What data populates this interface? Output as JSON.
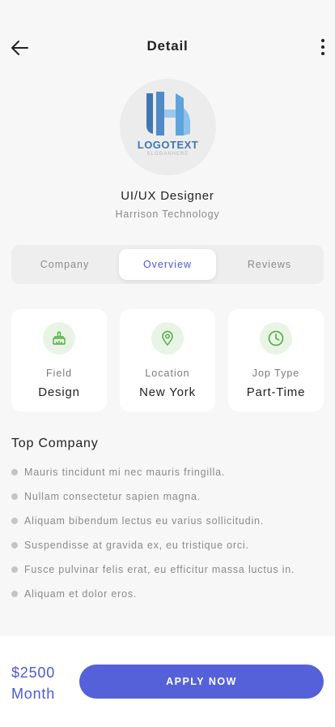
{
  "header": {
    "title": "Detail",
    "back_icon": "arrow-left-icon",
    "menu_icon": "more-vertical-icon"
  },
  "logo": {
    "text": "LOGOTEXT",
    "slogan": "SLOGANHERE"
  },
  "job": {
    "title": "UI/UX Designer",
    "company": "Harrison Technology"
  },
  "tabs": [
    {
      "label": "Company",
      "active": false
    },
    {
      "label": "Overview",
      "active": true
    },
    {
      "label": "Reviews",
      "active": false
    }
  ],
  "info_cards": [
    {
      "icon": "brush-icon",
      "label": "Field",
      "value": "Design"
    },
    {
      "icon": "location-pin-icon",
      "label": "Location",
      "value": "New York"
    },
    {
      "icon": "clock-icon",
      "label": "Jop Type",
      "value": "Part-Time"
    }
  ],
  "section": {
    "title": "Top Company",
    "bullets": [
      "Mauris tincidunt mi nec mauris fringilla.",
      "Nullam consectetur sapien magna.",
      "Aliquam bibendum lectus eu varius sollicitudin.",
      "Suspendisse at gravida ex, eu tristique orci.",
      "Fusce pulvinar felis erat, eu efficitur massa luctus in.",
      "Aliquam et dolor eros."
    ]
  },
  "footer": {
    "price": "$2500",
    "period": "Month",
    "apply_label": "APPLY NOW"
  },
  "colors": {
    "accent": "#5561d8",
    "icon_green": "#4caf3a",
    "icon_bg": "#e9f4e6",
    "background": "#f7f7f7"
  }
}
